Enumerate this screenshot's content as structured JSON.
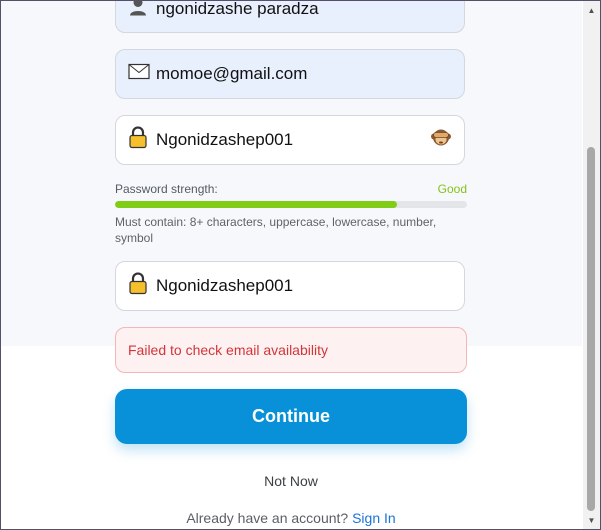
{
  "form": {
    "name_value": "ngonidzashe paradza",
    "email_value": "momoe@gmail.com",
    "password_value": "Ngonidzashep001",
    "confirm_value": "Ngonidzashep001",
    "password_strength_label": "Password strength:",
    "password_strength_value": "Good",
    "password_strength_percent": 80,
    "password_hint": "Must contain: 8+ characters, uppercase, lowercase, number, symbol"
  },
  "error": {
    "message": "Failed to check email availability"
  },
  "actions": {
    "continue_label": "Continue",
    "not_now_label": "Not Now",
    "signin_prompt": "Already have an account?",
    "signin_link": "Sign In"
  },
  "icons": {
    "name_field": "user-icon",
    "email_field": "envelope-icon",
    "password_field": "lock-icon",
    "password_toggle": "see-no-evil-monkey-icon",
    "confirm_field": "lock-icon"
  },
  "colors": {
    "primary": "#0891d8",
    "strength_good": "#80cc16",
    "error_text": "#d2353a",
    "link": "#1a73d9"
  }
}
